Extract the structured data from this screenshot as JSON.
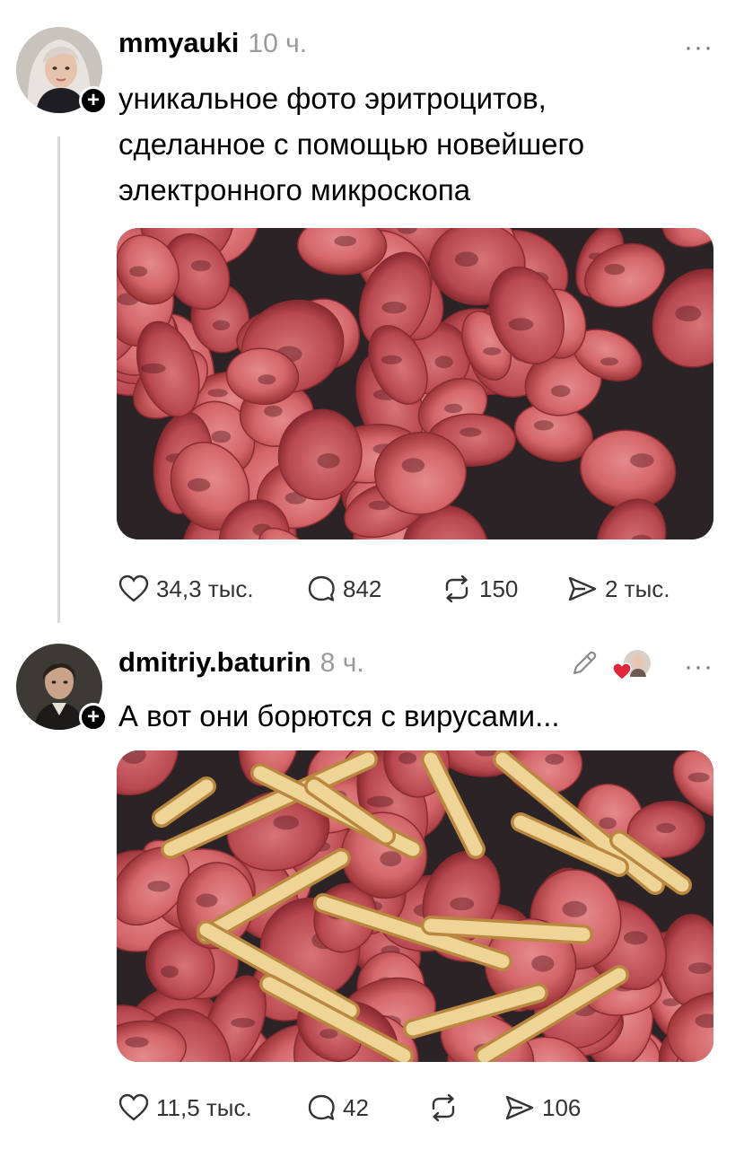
{
  "posts": [
    {
      "username": "mmyauki",
      "time": "10 ч.",
      "text_lines": [
        "уникальное фото эритроцитов,",
        "сделанное с помощью новейшего",
        "электронного микроскопа"
      ],
      "more_label": "···",
      "actions": {
        "likes": "34,3 тыс.",
        "comments": "842",
        "reposts": "150",
        "shares": "2 тыс."
      },
      "avatar": "woman-avatar",
      "image": "fried-sausage-slices-photo"
    },
    {
      "username": "dmitriy.baturin",
      "time": "8 ч.",
      "text_lines": [
        "А вот они борются с вирусами..."
      ],
      "more_label": "···",
      "actions": {
        "likes": "11,5 тыс.",
        "comments": "42",
        "reposts": "",
        "shares": "106"
      },
      "avatar": "man-avatar",
      "image": "sausage-slices-with-fries-photo"
    }
  ],
  "icons": {
    "like": "heart-icon",
    "comment": "comment-icon",
    "repost": "repost-icon",
    "share": "send-icon",
    "edit": "pencil-icon",
    "follow": "plus-icon",
    "more": "ellipsis-icon"
  },
  "colors": {
    "liked_heart": "#e0263f",
    "muted_text": "#9a9a9a",
    "thread_line": "#d9d9d9"
  }
}
